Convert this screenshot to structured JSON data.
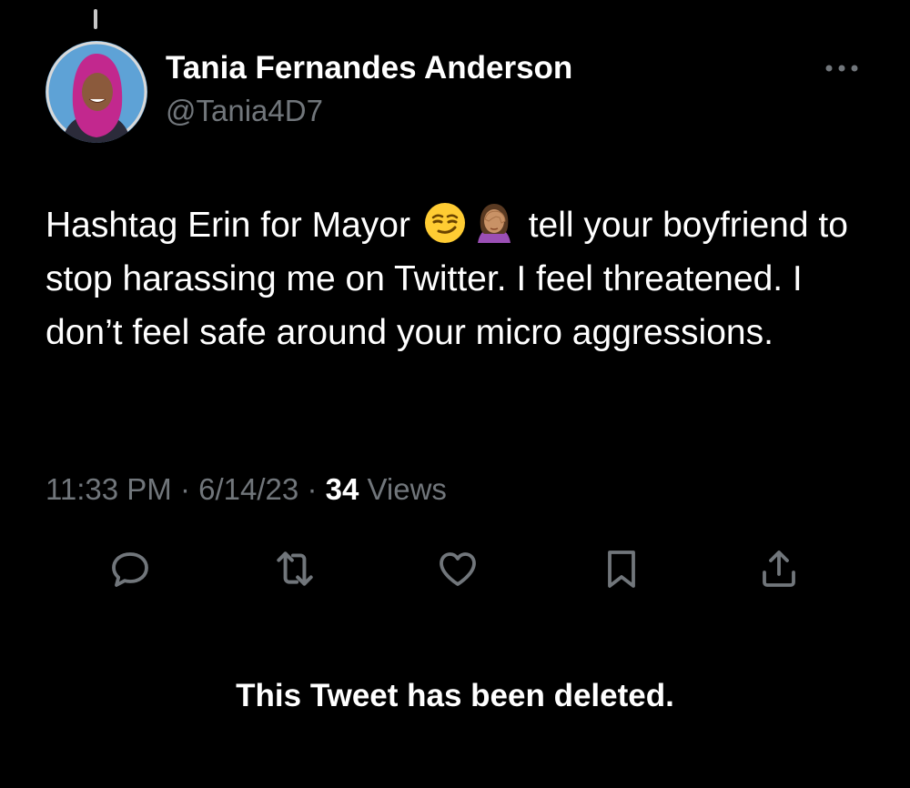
{
  "tweet": {
    "author_name": "Tania Fernandes Anderson",
    "author_handle": "@Tania4D7",
    "text_part1": "Hashtag Erin for Mayor",
    "text_part2": "tell your boyfriend to stop harassing me on Twitter. I feel threatened. I don’t feel safe around your micro aggressions.",
    "emojis": [
      "smirking-face",
      "person-facepalming"
    ],
    "time": "11:33 PM",
    "separator": "·",
    "date": "6/14/23",
    "views_count": "34",
    "views_label": "Views"
  },
  "actions": [
    "reply",
    "retweet",
    "like",
    "bookmark",
    "share"
  ],
  "notice": "This Tweet has been deleted.",
  "colors": {
    "background": "#000000",
    "text": "#ffffff",
    "muted": "#71767b",
    "icon": "#71767b"
  }
}
